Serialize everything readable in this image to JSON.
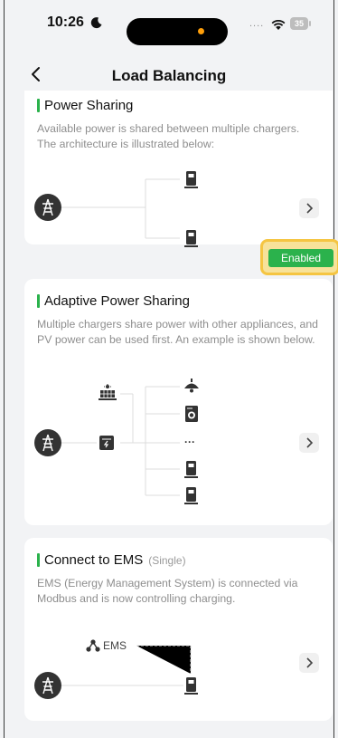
{
  "status_bar": {
    "time": "10:26",
    "battery": "35"
  },
  "nav": {
    "title": "Load Balancing"
  },
  "cards": [
    {
      "title": "Power Sharing",
      "description": "Available power is shared between multiple chargers. The architecture is illustrated below:",
      "badge": "Enabled"
    },
    {
      "title": "Adaptive Power Sharing",
      "description": "Multiple chargers share power with other appliances, and PV power can be used first. An example is shown below.",
      "ellipsis": "···"
    },
    {
      "title": "Connect to EMS",
      "subtitle": "(Single)",
      "description": "EMS (Energy Management System) is connected via Modbus and is now controlling charging.",
      "ems_label": "EMS"
    }
  ],
  "icons": [
    "moon-icon",
    "wifi-icon",
    "battery-icon",
    "back-icon",
    "grid-tower-icon",
    "charger-icon",
    "chevron-right-icon",
    "solar-panel-icon",
    "inverter-icon",
    "lamp-icon",
    "washing-machine-icon",
    "network-icon"
  ],
  "colors": {
    "accent": "#2bb24c",
    "highlight": "#f5c542"
  }
}
